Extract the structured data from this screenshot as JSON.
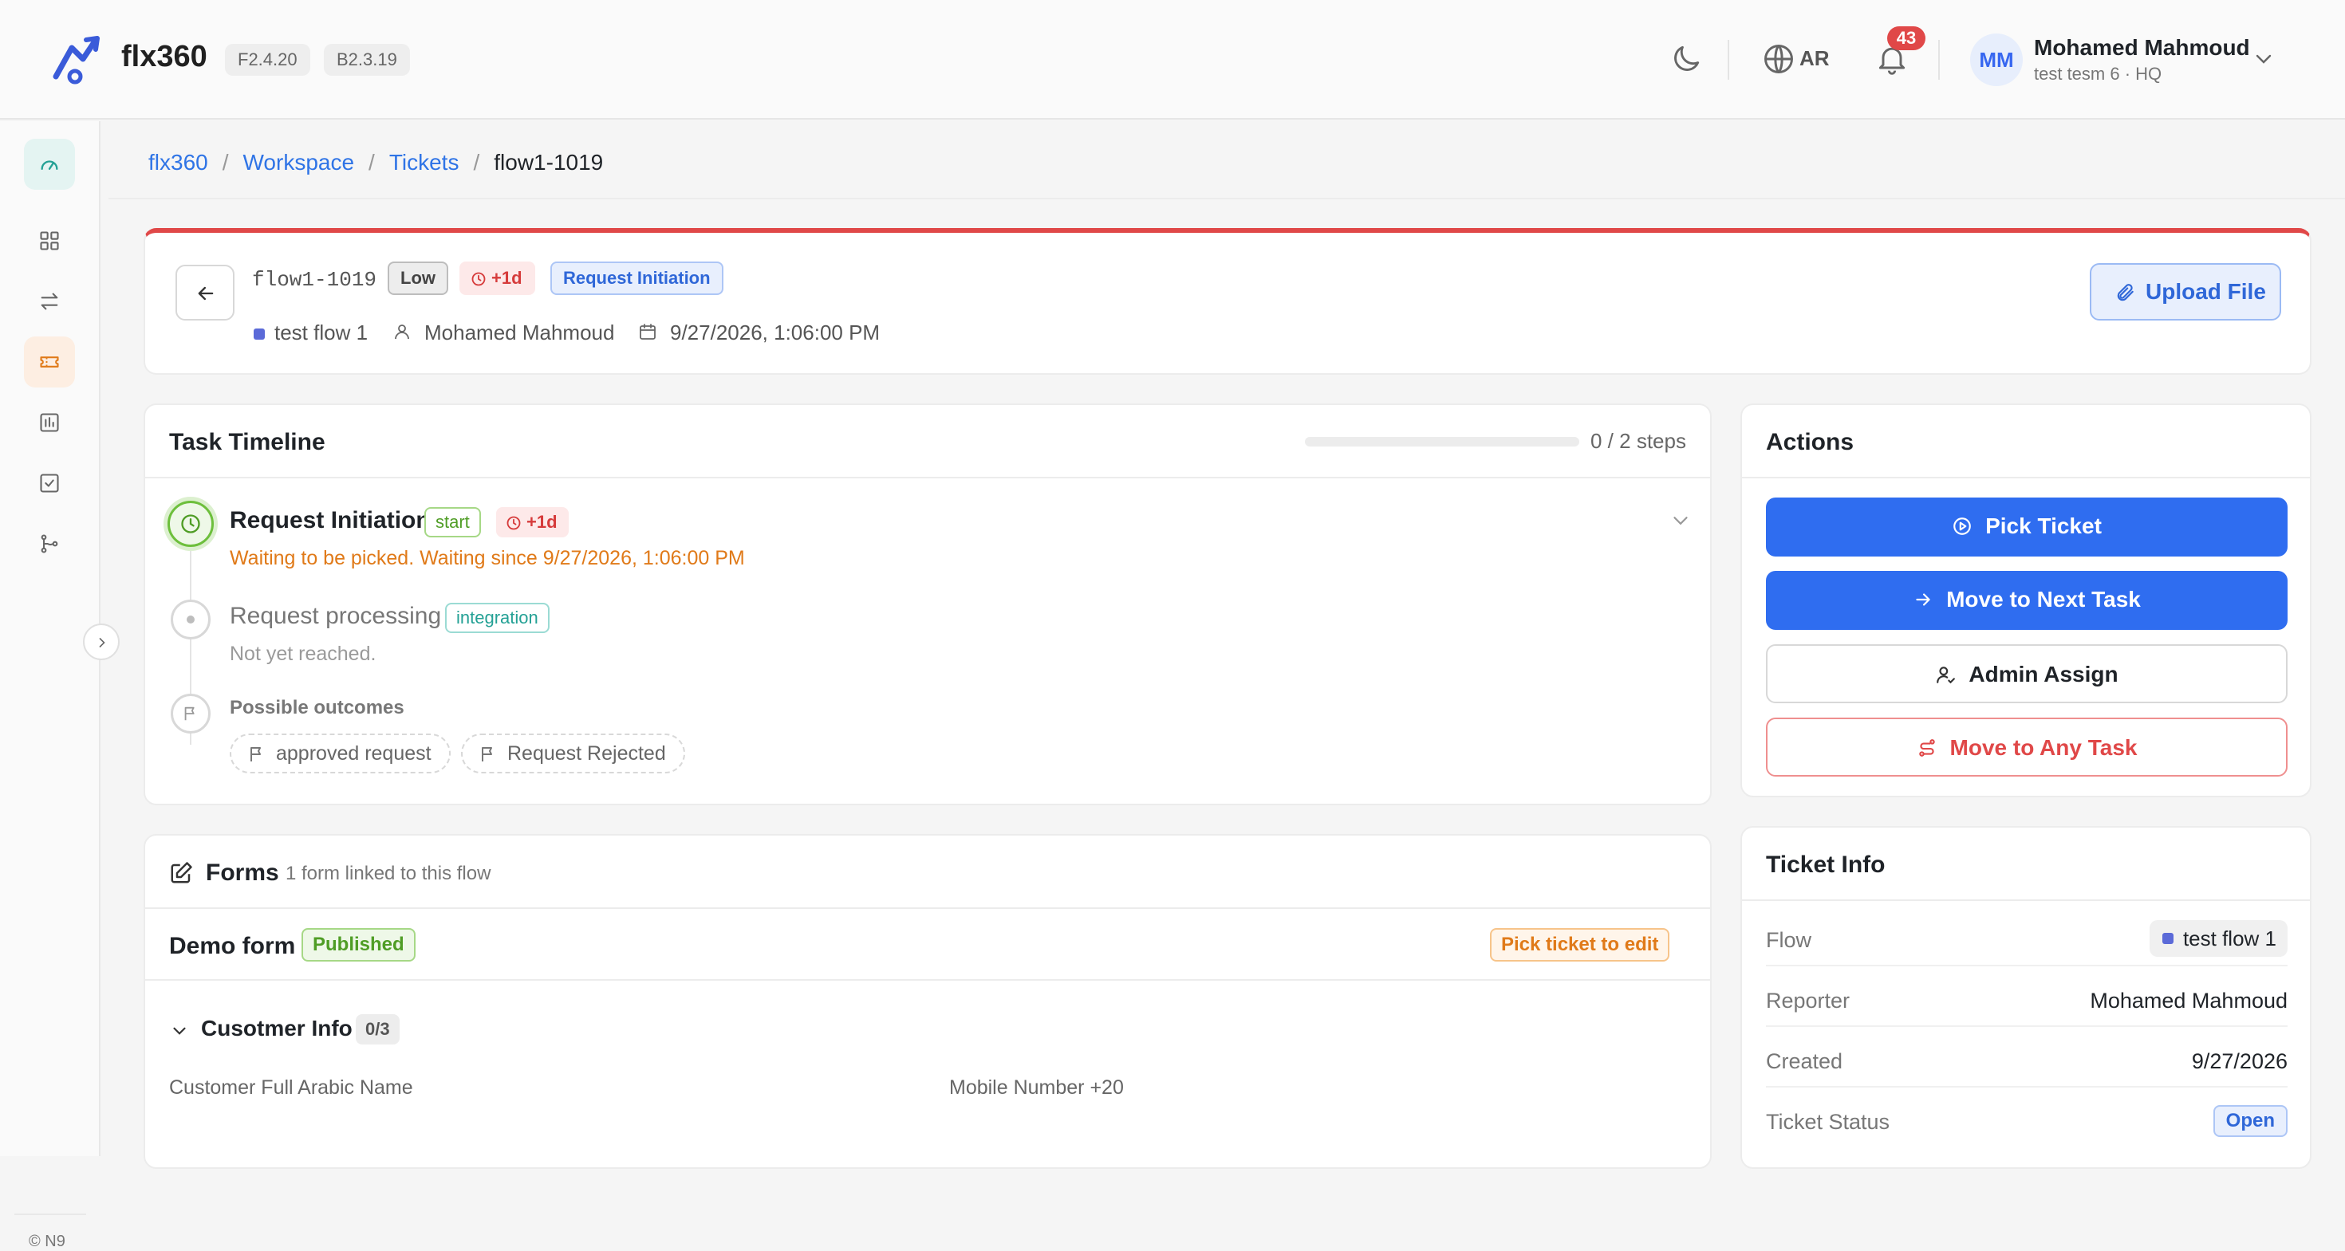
{
  "header": {
    "app_name": "flx360",
    "frontend_version": "F2.4.20",
    "backend_version": "B2.3.19",
    "language": "AR",
    "notification_count": "43",
    "user_initials": "MM",
    "user_name": "Mohamed Mahmoud",
    "user_sub": "test tesm 6 · HQ"
  },
  "breadcrumb": [
    "flx360",
    "Workspace",
    "Tickets",
    "flow1-1019"
  ],
  "ticket": {
    "code": "flow1-1019",
    "priority": "Low",
    "overdue": "+1d",
    "stage": "Request Initiation",
    "flow": "test flow 1",
    "reporter": "Mohamed Mahmoud",
    "created": "9/27/2026, 1:06:00 PM",
    "upload_label": "Upload File"
  },
  "timeline": {
    "title": "Task Timeline",
    "progress": 0,
    "steps_label": "0 / 2 steps",
    "steps": [
      {
        "title": "Request Initiation",
        "tag": "start",
        "overdue": "+1d",
        "sub": "Waiting to be picked. Waiting since 9/27/2026, 1:06:00 PM"
      },
      {
        "title": "Request processing",
        "tag": "integration",
        "sub": "Not yet reached."
      }
    ],
    "outcomes_title": "Possible outcomes",
    "outcomes": [
      "approved request",
      "Request Rejected"
    ]
  },
  "actions": {
    "title": "Actions",
    "pick": "Pick Ticket",
    "next": "Move to Next Task",
    "assign": "Admin Assign",
    "any": "Move to Any Task"
  },
  "forms": {
    "title": "Forms",
    "subtitle": "1 form linked to this flow",
    "form_name": "Demo form",
    "form_status": "Published",
    "pick_note": "Pick ticket to edit",
    "section_name": "Cusotmer Info",
    "section_count": "0/3",
    "fields": [
      "Customer Full Arabic Name",
      "Mobile Number +20"
    ]
  },
  "ticket_info": {
    "title": "Ticket Info",
    "rows": [
      {
        "key": "Flow",
        "value": "test flow 1"
      },
      {
        "key": "Reporter",
        "value": "Mohamed Mahmoud"
      },
      {
        "key": "Created",
        "value": "9/27/2026"
      },
      {
        "key": "Ticket Status",
        "value": "Open"
      }
    ]
  },
  "footer": "© N9",
  "colors": {
    "primary": "#2f6df0",
    "danger": "#e04848",
    "warning": "#e07a19",
    "success": "#4f9d25"
  }
}
